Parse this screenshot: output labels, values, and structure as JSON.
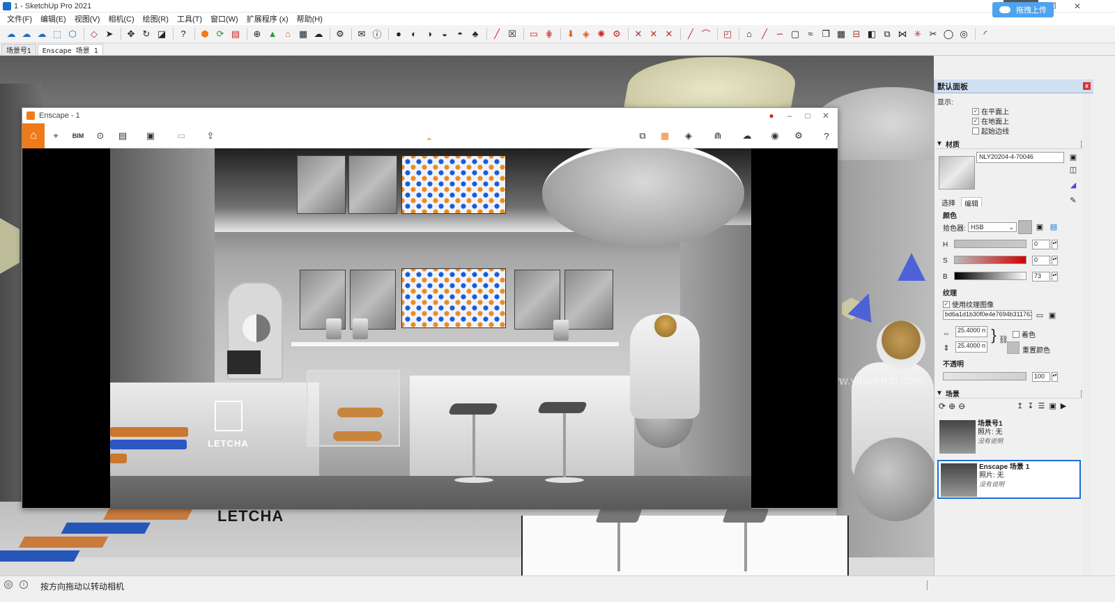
{
  "app": {
    "title": "1 - SketchUp Pro 2021",
    "upload_button": "拖拽上传"
  },
  "menu": [
    "文件(F)",
    "编辑(E)",
    "视图(V)",
    "相机(C)",
    "绘图(R)",
    "工具(T)",
    "窗口(W)",
    "扩展程序 (x)",
    "帮助(H)"
  ],
  "scene_tabs": [
    "场景号1",
    "Enscape 场景 1"
  ],
  "enscape": {
    "title": "Enscape - 1",
    "bim_label": "BIM",
    "logo_text": "LETCHA"
  },
  "viewport": {
    "logo_text": "LETCHA",
    "watermark": "www.yituoHub.com"
  },
  "panel": {
    "title": "默认面板",
    "show_label": "显示:",
    "checks": [
      "在平面上",
      "在地面上",
      "起始边线"
    ],
    "materials_section": "材质",
    "material_name": "NLY20204-4-70046",
    "subtabs": [
      "选择",
      "编辑"
    ],
    "color_label": "颜色",
    "picker_label": "拾色器:",
    "picker_value": "HSB",
    "h_label": "H",
    "h_value": "0",
    "s_label": "S",
    "s_value": "0",
    "b_label": "B",
    "b_value": "73",
    "texture_label": "纹理",
    "use_texture": "使用纹理图像",
    "texture_file": "bd6a1d1b30f0e4e7694b311763",
    "width_value": "25.4000 n",
    "height_value": "25.4000 n",
    "colorize_label": "着色",
    "reset_color_label": "重置颜色",
    "opacity_label": "不透明",
    "opacity_value": "100",
    "scenes_section": "场景",
    "scenes": [
      {
        "name": "场景号1",
        "photo": "照片: 无",
        "desc": "没有说明"
      },
      {
        "name": "Enscape 场景 1",
        "photo": "照片: 无",
        "desc": "没有说明"
      }
    ]
  },
  "status": {
    "text": "按方向拖动以转动相机"
  },
  "colors": {
    "enscape_orange": "#f07a1a",
    "selection_blue": "#1a6fd6",
    "panel_header": "#cfe0f1"
  }
}
